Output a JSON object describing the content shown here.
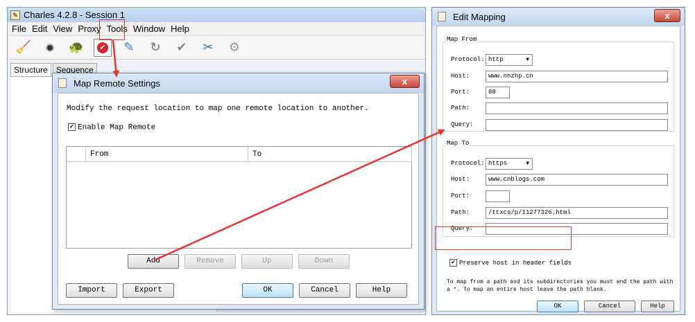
{
  "charles": {
    "title": "Charles 4.2.8 - Session 1",
    "menu": [
      "File",
      "Edit",
      "View",
      "Proxy",
      "Tools",
      "Window",
      "Help"
    ],
    "tabs": [
      "Structure",
      "Sequence"
    ]
  },
  "map_remote": {
    "title": "Map Remote Settings",
    "description": "Modify the request location to map one remote location to another.",
    "enable_label": "Enable Map Remote",
    "columns": [
      "From",
      "To"
    ],
    "buttons": {
      "add": "Add",
      "remove": "Remove",
      "up": "Up",
      "down": "Down",
      "import": "Import",
      "export": "Export",
      "ok": "OK",
      "cancel": "Cancel",
      "help": "Help"
    },
    "close_glyph": "x"
  },
  "edit_mapping": {
    "title": "Edit Mapping",
    "map_from": {
      "label": "Map From",
      "protocol_label": "Protocol:",
      "protocol": "http",
      "host_label": "Host:",
      "host": "www.nnzhp.cn",
      "port_label": "Port:",
      "port": "80",
      "path_label": "Path:",
      "path": "",
      "query_label": "Query:",
      "query": ""
    },
    "map_to": {
      "label": "Map To",
      "protocol_label": "Protocol:",
      "protocol": "https",
      "host_label": "Host:",
      "host": "www.cnblogs.com",
      "port_label": "Port:",
      "port": "",
      "path_label": "Path:",
      "path": "/ttxcs/p/11277326.html",
      "query_label": "Query:",
      "query": ""
    },
    "preserve_label": "Preserve host in header fields",
    "note": "To map from a path and its subdirectories you must end the path with a *. To map an entire host leave the path blank.",
    "buttons": {
      "ok": "OK",
      "cancel": "Cancel",
      "help": "Help"
    },
    "close_glyph": "x"
  },
  "colors": {
    "highlight": "#e0393a",
    "arrow": "#e8342e"
  }
}
